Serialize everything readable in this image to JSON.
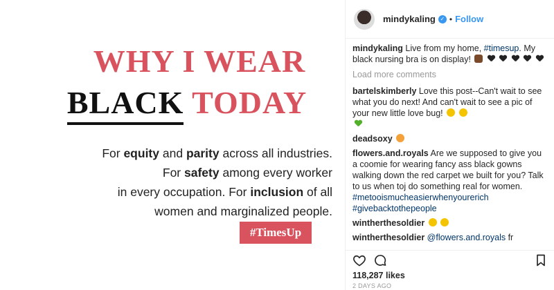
{
  "post": {
    "headline_line1": "WHY I WEAR",
    "headline_black": "BLACK",
    "headline_today": "TODAY",
    "body_l1a": "For ",
    "body_l1b": "equity",
    "body_l1c": " and ",
    "body_l1d": "parity",
    "body_l1e": " across all industries.",
    "body_l2a": "For ",
    "body_l2b": "safety",
    "body_l2c": " among every worker",
    "body_l3a": "in every occupation. For ",
    "body_l3b": "inclusion",
    "body_l3c": " of all",
    "body_l4": "women and marginalized people.",
    "hashtag": "#TimesUp"
  },
  "header": {
    "username": "mindykaling",
    "verified_icon": "check-icon",
    "separator": "•",
    "follow_label": "Follow"
  },
  "caption": {
    "user": "mindykaling",
    "text_a": " Live from my home, ",
    "tag": "#timesup",
    "text_b": ". My black nursing bra is on display!"
  },
  "load_more": "Load more comments",
  "comments": [
    {
      "user": "bartelskimberly",
      "text": " Love this post--Can't wait to see what you do next! And can't wait to see a pic of your new little love bug!"
    },
    {
      "user": "deadsoxy",
      "text": ""
    },
    {
      "user": "flowers.and.royals",
      "text": " Are we supposed to give you a coomie for wearing fancy ass black gowns walking down the red carpet we built for you? Talk to us when toj do something real for women.",
      "tag1": "#metooismucheasierwhenyourerich",
      "tag2": "#givebacktothepeople"
    },
    {
      "user": "wintherthesoldier",
      "text": ""
    },
    {
      "user": "wintherthesoldier",
      "mention": "@flowers.and.royals",
      "text": " fr"
    }
  ],
  "likes": "118,287 likes",
  "age": "2 DAYS AGO",
  "colors": {
    "accent_red": "#d9535e",
    "link_blue": "#3897f0",
    "tag_blue": "#003569"
  },
  "icons": [
    "heart-icon",
    "comment-icon",
    "bookmark-icon"
  ]
}
